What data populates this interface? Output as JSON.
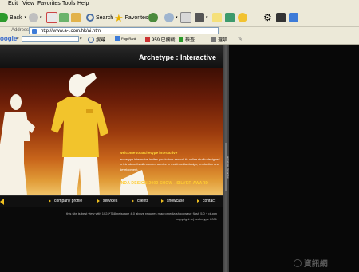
{
  "menu": [
    "Edit",
    "View",
    "Favorites",
    "Tools",
    "Help"
  ],
  "toolbar": {
    "back_label": "Back",
    "search_label": "Search",
    "favorites_label": "Favorites"
  },
  "address": {
    "label": "Address",
    "url": "http://www.a-i.com.hk/ai.html"
  },
  "googlebar": {
    "logo": "oogle",
    "search_label": "搜尋",
    "pagerank_label": "PageRank",
    "blocked_label": "959 已攔截",
    "check_label": "檢查",
    "options_label": "選項"
  },
  "site": {
    "title": "Archetype : Interactive",
    "welcome": "welcome to archetype interactive",
    "intro": "archetype interactive invites you to tour around its online studio designed to introduce its all rounded service in multi-media design, production and development.",
    "award": "INDA DESIGN 2002 SHOW - SILVER AWARD",
    "nav": [
      "company profile",
      "services",
      "clients",
      "showcase",
      "contact"
    ],
    "footer_line1": "this site is best view with 1024*768 netscape 4.0 above requires macromedia shockwave flash 5.0 + plugin",
    "footer_line2": "copyright (c) archetype 2001",
    "sidebar_text": "archetype interactive",
    "watermark": "◯ 資訊網"
  },
  "colors": {
    "accent_yellow": "#ffd83a",
    "nav_arrow": "#f0c020",
    "hero_dark": "#3c0e04",
    "hero_light": "#f0c46a"
  }
}
